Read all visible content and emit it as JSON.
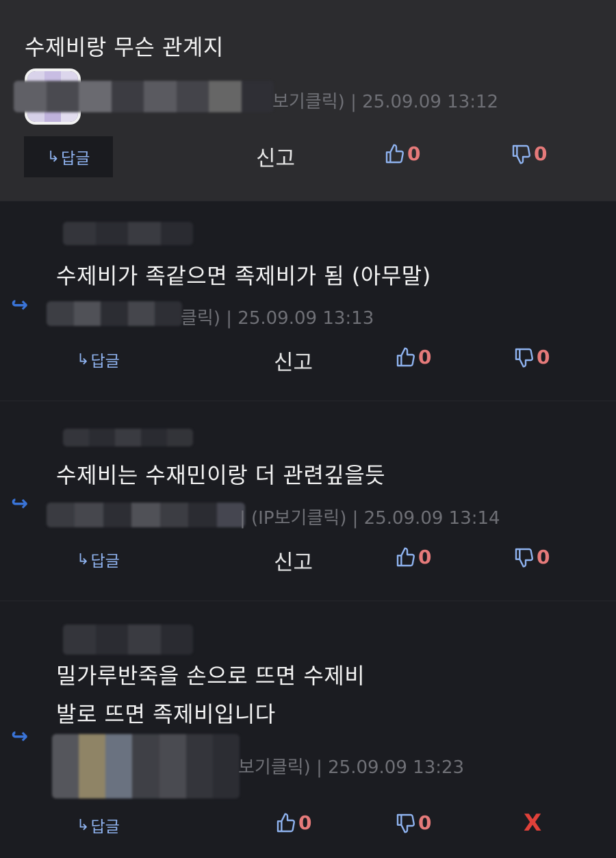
{
  "comments": [
    {
      "text": "수제비랑 무슨 관계지",
      "meta": "보기클릭) | 25.09.09 13:12",
      "reply_label": "답글",
      "report_label": "신고",
      "likes": "0",
      "dislikes": "0"
    },
    {
      "text": "수제비가 족같으면 족제비가 됨 (아무말)",
      "meta": "클릭) | 25.09.09 13:13",
      "reply_label": "답글",
      "report_label": "신고",
      "likes": "0",
      "dislikes": "0"
    },
    {
      "text": "수제비는 수재민이랑 더 관련깊을듯",
      "meta": "| (IP보기클릭) | 25.09.09 13:14",
      "reply_label": "답글",
      "report_label": "신고",
      "likes": "0",
      "dislikes": "0"
    },
    {
      "text_line1": "밀가루반죽을 손으로 뜨면 수제비",
      "text_line2": "발로 뜨면 족제비입니다",
      "meta": "보기클릭) | 25.09.09 13:23",
      "reply_label": "답글",
      "likes": "0",
      "dislikes": "0",
      "delete_label": "X"
    }
  ],
  "icons": {
    "reply_arrow": "curved-reply-arrow-icon",
    "like": "thumbs-up-icon",
    "dislike": "thumbs-down-icon"
  },
  "colors": {
    "accent_blue": "#3a74d8",
    "count_red": "#e57a7a",
    "delete_red": "#e0413a",
    "bg_first": "#2c2c2f",
    "bg_other": "#1b1c21"
  }
}
